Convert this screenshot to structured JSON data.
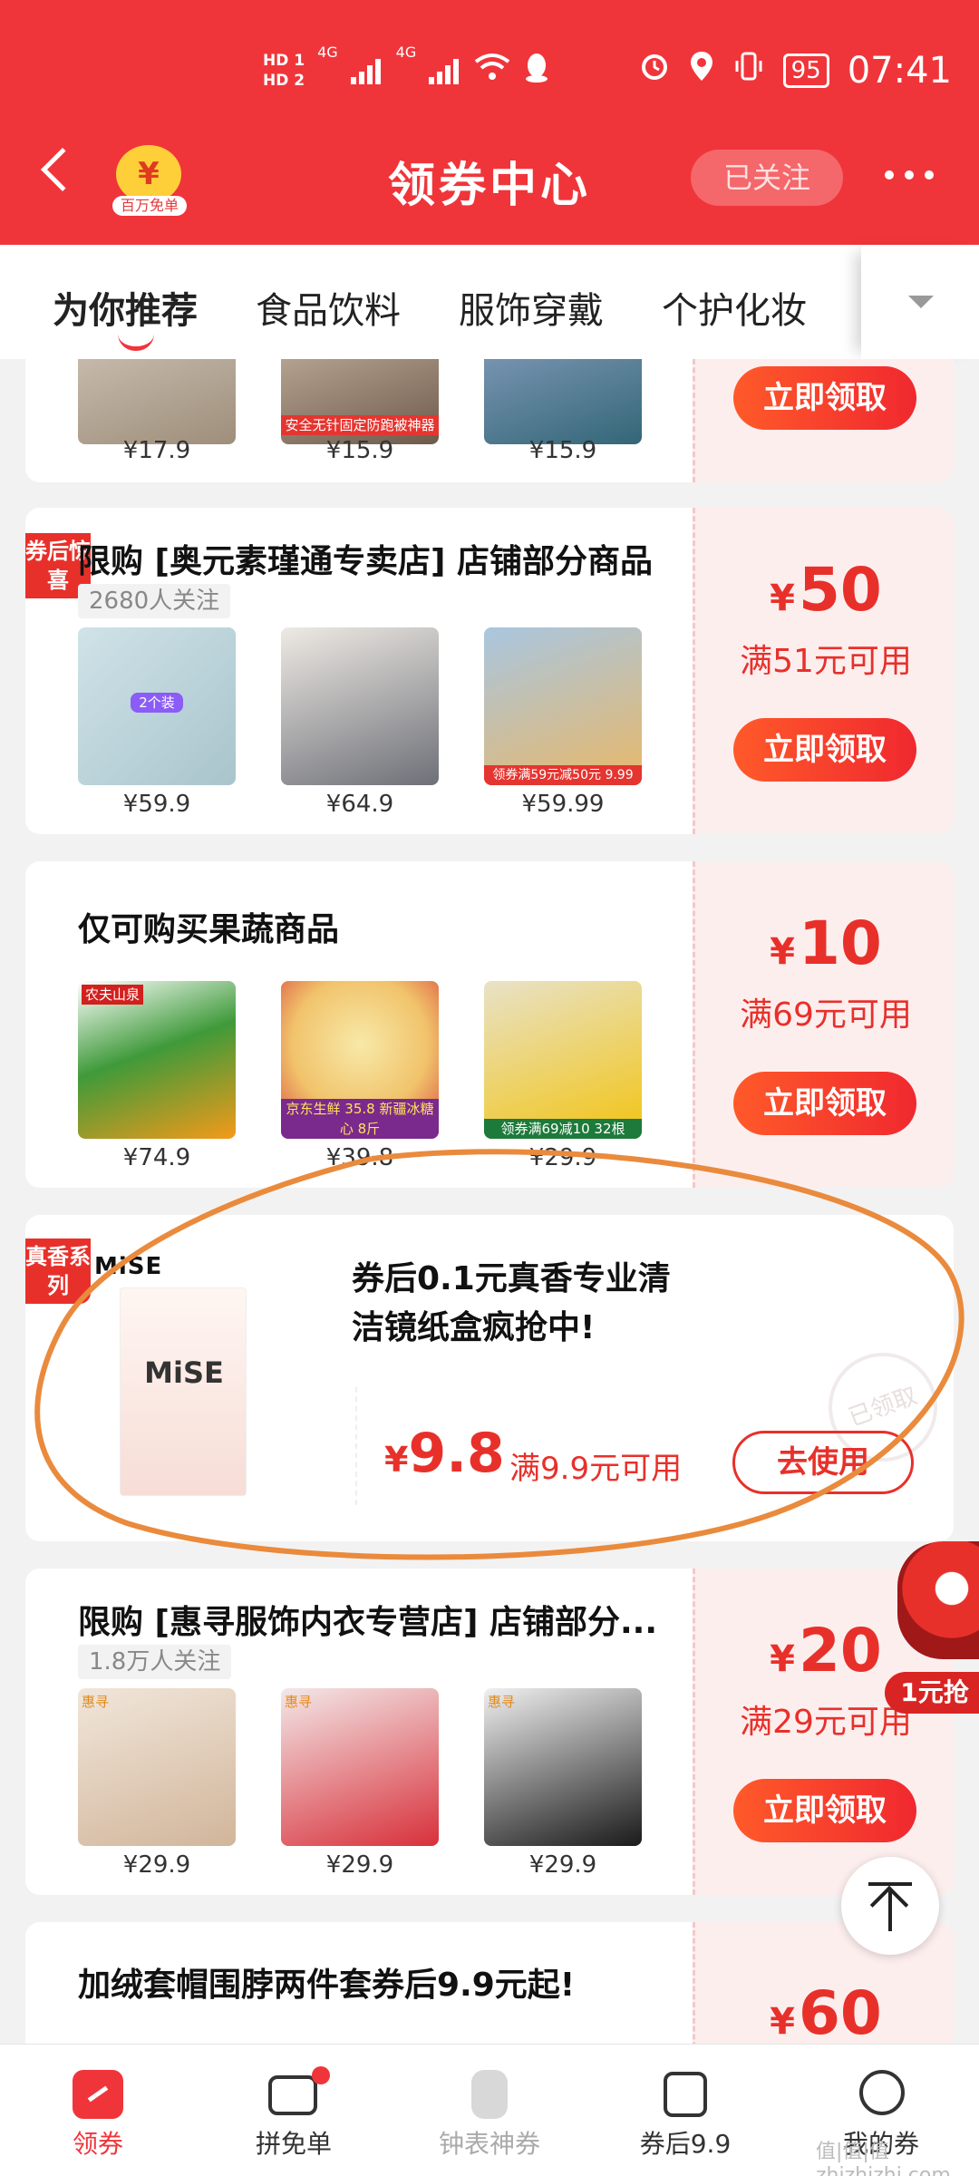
{
  "status_bar": {
    "hd1": "HD 1",
    "hd2": "HD 2",
    "net1": "4G",
    "net2": "4G",
    "battery": "95",
    "time": "07:41"
  },
  "header": {
    "badge_label": "百万免单",
    "title": "领券中心",
    "follow_label": "已关注"
  },
  "tabs": [
    "为你推荐",
    "食品饮料",
    "服饰穿戴",
    "个护化妆"
  ],
  "cards": [
    {
      "button": "立即领取",
      "prices": [
        "¥17.9",
        "¥15.9",
        "¥15.9"
      ],
      "img_text": [
        "",
        "安全无针固定防跑被神器",
        ""
      ]
    },
    {
      "corner": "券后惊喜",
      "title": "限购 [奥元素瑾通专卖店] 店铺部分商品",
      "followers": "2680人关注",
      "amount": "50",
      "condition": "满51元可用",
      "button": "立即领取",
      "prices": [
        "¥59.9",
        "¥64.9",
        "¥59.99"
      ],
      "img_text": [
        "2个装",
        "",
        "领券满59元减50元 9.99"
      ]
    },
    {
      "title": "仅可购买果蔬商品",
      "amount": "10",
      "condition": "满69元可用",
      "button": "立即领取",
      "prices": [
        "¥74.9",
        "¥39.8",
        "¥29.9"
      ],
      "img_text": [
        "农夫山泉",
        "京东生鲜 35.8 新疆冰糖心 8斤",
        "领券满69减10 32根"
      ]
    },
    {
      "corner": "真香系列",
      "brand": "MiSE",
      "title": "券后0.1元真香专业清洁镜纸盒疯抢中!",
      "amount": "9.8",
      "condition": "满9.9元可用",
      "button": "去使用",
      "stamp": "已领取",
      "product_text": "MiSE"
    },
    {
      "title": "限购 [惠寻服饰内衣专营店] 店铺部分...",
      "followers": "1.8万人关注",
      "amount": "20",
      "condition": "满29元可用",
      "button": "立即领取",
      "prices": [
        "¥29.9",
        "¥29.9",
        "¥29.9"
      ],
      "img_text": [
        "惠寻",
        "惠寻",
        "惠寻"
      ]
    },
    {
      "title": "加绒套帽围脖两件套券后9.9元起!",
      "amount": "60"
    }
  ],
  "promo_float": {
    "label": "1元抢"
  },
  "bottom_nav": [
    "领券",
    "拼免单",
    "钟表神券",
    "券后9.9",
    "我的券"
  ],
  "watermark": "值|值|值 zhizhizhi.com",
  "colors": {
    "brand_red": "#f0353a",
    "coupon_red": "#e8302a",
    "coupon_bg": "#fdeeee"
  }
}
